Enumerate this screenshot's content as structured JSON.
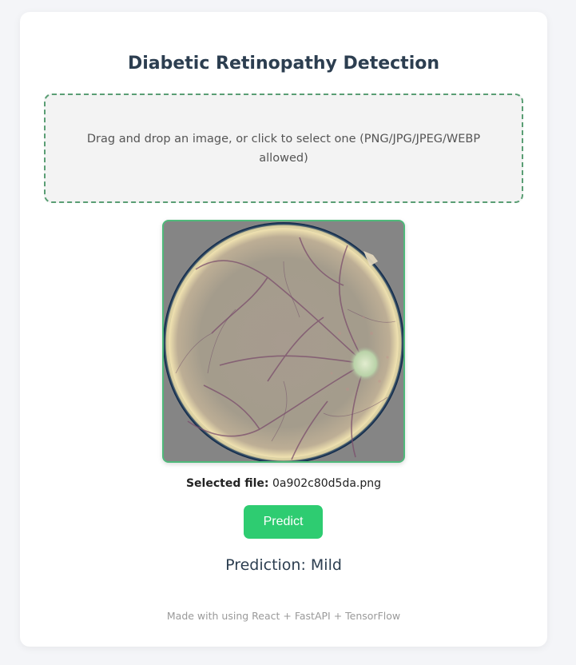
{
  "header": {
    "title": "Diabetic Retinopathy Detection"
  },
  "upload": {
    "instructions": "Drag and drop an image, or click to select one (PNG/JPG/JPEG/WEBP allowed)"
  },
  "preview": {
    "image_subject": "retina fundus image"
  },
  "selected_file": {
    "label": "Selected file:",
    "name": "0a902c80d5da.png"
  },
  "actions": {
    "predict_label": "Predict"
  },
  "result": {
    "text": "Prediction: Mild"
  },
  "footer": {
    "text": "Made with using React + FastAPI + TensorFlow"
  },
  "colors": {
    "accent_green": "#2ecc71",
    "title_color": "#2c3e50",
    "dropzone_border": "#5a9e74",
    "page_background": "#f4f5f8"
  }
}
